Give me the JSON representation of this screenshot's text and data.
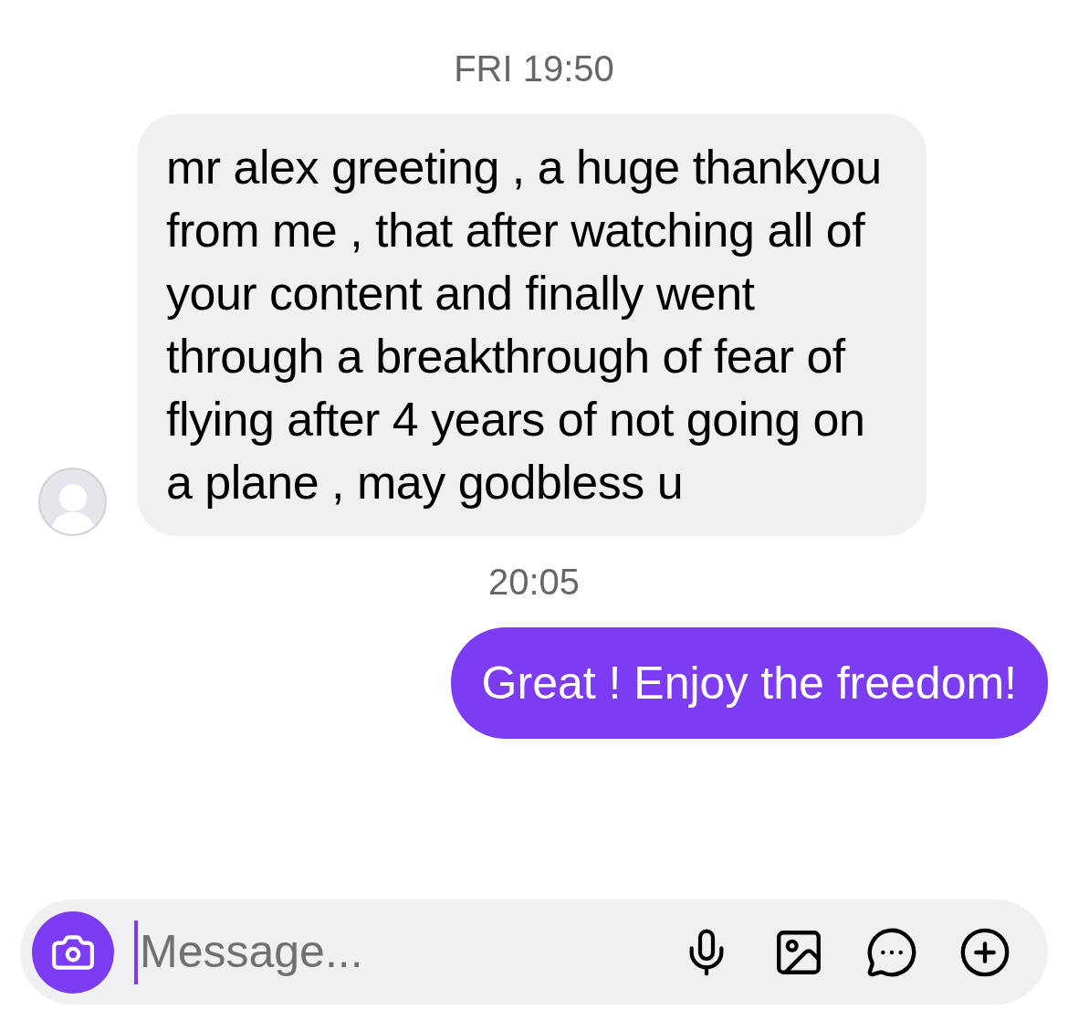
{
  "messages": [
    {
      "kind": "timestamp",
      "text": "FRI 19:50"
    },
    {
      "kind": "incoming",
      "text": "mr alex greeting , a huge thankyou from me , that after watching all of your content and finally went through a breakthrough of fear of flying after 4 years of not going on a plane , may godbless u"
    },
    {
      "kind": "timestamp",
      "text": "20:05"
    },
    {
      "kind": "outgoing",
      "text": "Great ! Enjoy the freedom!"
    }
  ],
  "composer": {
    "placeholder": "Message..."
  }
}
